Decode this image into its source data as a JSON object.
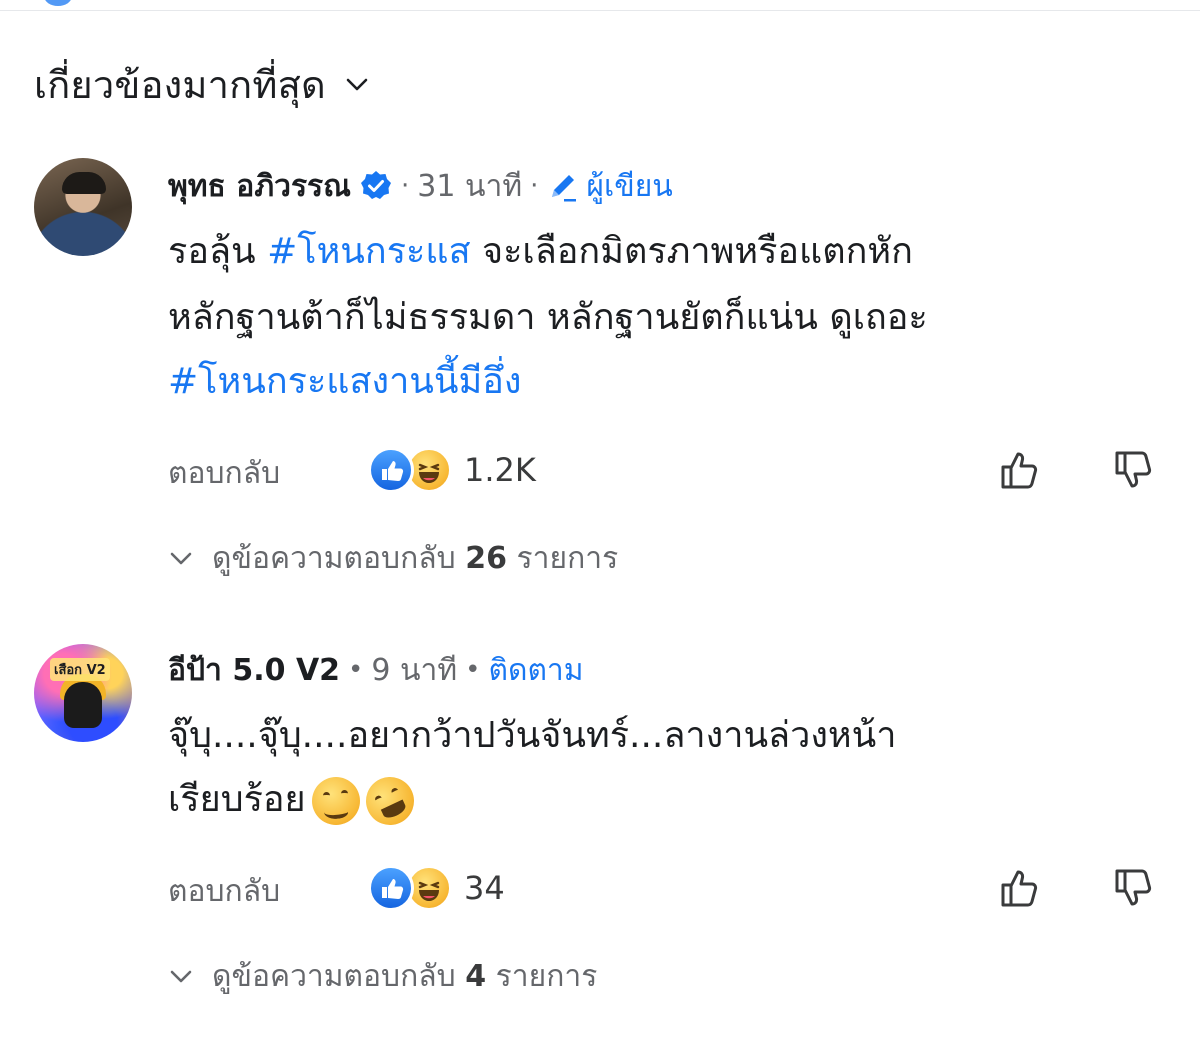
{
  "header": {
    "sort_label": "เกี่ยวข้องมากที่สุด",
    "sort_icon": "chevron-down-icon"
  },
  "comments": [
    {
      "author": "พุทธ อภิวรรณ",
      "verified": true,
      "separator": "·",
      "time": "31 นาที",
      "author_tag": "ผู้เขียน",
      "body_lines": [
        {
          "before": "รอลุ้น ",
          "tag": "#โหนกระแส",
          "after": " จะเลือกมิตรภาพหรือแตกหัก"
        },
        {
          "before": "หลักฐานต้าก็ไม่ธรรมดา หลักฐานยัตก็แน่น ดูเถอะ",
          "tag": "",
          "after": ""
        },
        {
          "before": "",
          "tag": "#โหนกระแสงานนี้มีอึ่ง",
          "after": ""
        }
      ],
      "reply_label": "ตอบกลับ",
      "reaction_count": "1.2K",
      "reactions": [
        "like",
        "haha"
      ],
      "view_replies": {
        "prefix": "ดูข้อความตอบกลับ",
        "count": "26",
        "suffix": "รายการ"
      }
    },
    {
      "author": "อีป้า 5.0 V2",
      "verified": false,
      "separator": "•",
      "time": "9 นาที",
      "follow_label": "ติดตาม",
      "avatar_caption": "เสือก V2",
      "body_lines": [
        {
          "before": "จุ๊บุ....จุ๊บุ....อยากว้าปวันจันทร์...ลางานล่วงหน้า",
          "tag": "",
          "after": ""
        },
        {
          "before": "เรียบร้อย",
          "tag": "",
          "after": ""
        }
      ],
      "emojis": [
        "woozy-face",
        "rolling-on-floor-laughing"
      ],
      "reply_label": "ตอบกลับ",
      "reaction_count": "34",
      "reactions": [
        "like",
        "haha"
      ],
      "view_replies": {
        "prefix": "ดูข้อความตอบกลับ",
        "count": "4",
        "suffix": "รายการ"
      }
    }
  ],
  "colors": {
    "link_blue": "#1877f2",
    "secondary_text": "#65676b",
    "primary_text": "#1c1e21"
  }
}
